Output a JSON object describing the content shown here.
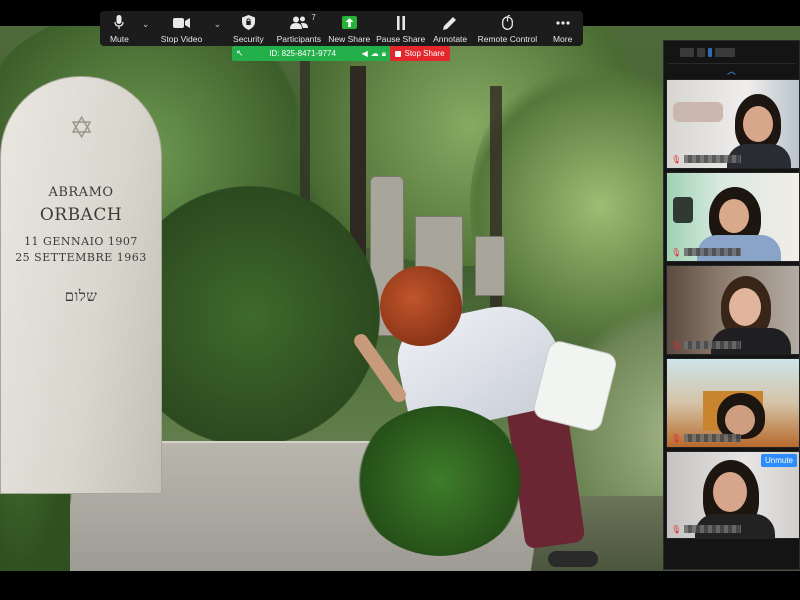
{
  "toolbar": {
    "items": [
      {
        "label": "Mute",
        "icon": "microphone-icon"
      },
      {
        "label": "Stop Video",
        "icon": "video-camera-icon"
      },
      {
        "label": "Security",
        "icon": "shield-icon"
      },
      {
        "label": "Participants",
        "icon": "participants-icon",
        "count": "7"
      },
      {
        "label": "New Share",
        "icon": "share-arrow-icon"
      },
      {
        "label": "Pause Share",
        "icon": "pause-icon"
      },
      {
        "label": "Annotate",
        "icon": "pencil-icon"
      },
      {
        "label": "Remote Control",
        "icon": "mouse-icon"
      },
      {
        "label": "More",
        "icon": "more-dots-icon"
      }
    ],
    "accent": "#25b23a"
  },
  "share_bar": {
    "meeting_id": "ID: 825-8471-9774",
    "stop_share_label": "Stop Share",
    "id_bar_color": "#23b04a",
    "stop_color": "#e3272d"
  },
  "shared_screen": {
    "headstone": {
      "first_name": "ABRAMO",
      "last_name": "ORBACH",
      "birth": "11 GENNAIO 1907",
      "death": "25 SETTEMBRE 1963",
      "hebrew": "שלום"
    }
  },
  "gallery": {
    "chevron": "︿",
    "unmute_label": "Unmute",
    "tile_count": 5
  }
}
